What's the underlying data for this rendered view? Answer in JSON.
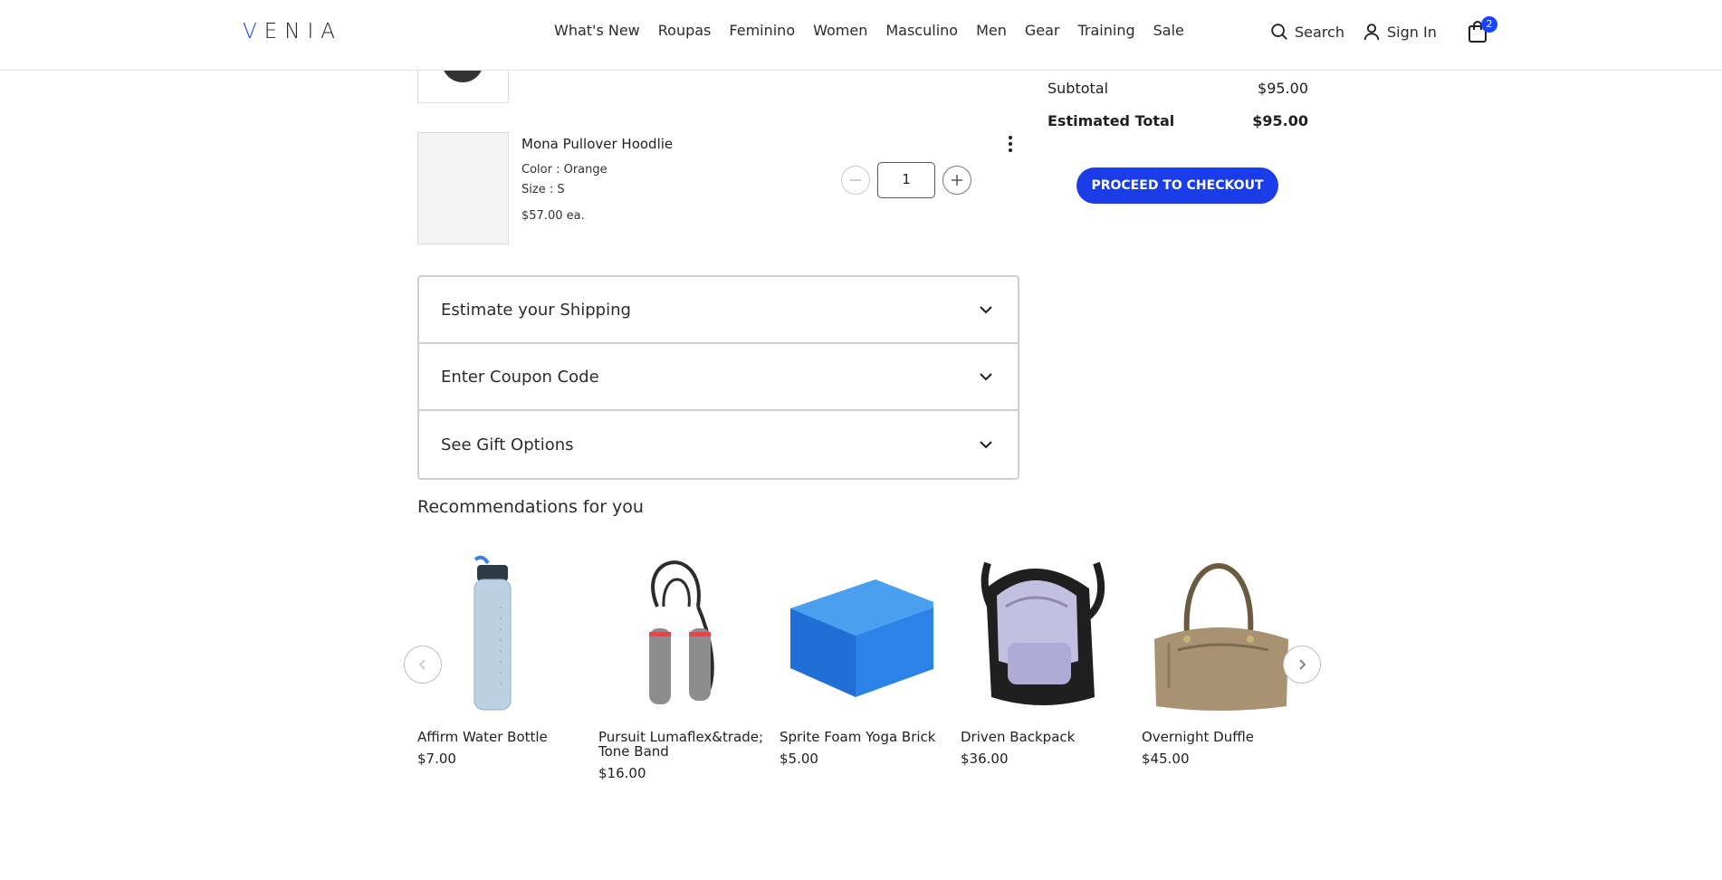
{
  "header": {
    "logo": "VENIA",
    "nav": [
      "What's New",
      "Roupas",
      "Feminino",
      "Women",
      "Masculino",
      "Men",
      "Gear",
      "Training",
      "Sale"
    ],
    "search_label": "Search",
    "signin_label": "Sign In",
    "cart_count": "2",
    "accent_color": "#1a44ff"
  },
  "cart": {
    "item": {
      "name": "Mona Pullover Hoodlie",
      "color": "Color : Orange",
      "size": "Size : S",
      "price": "$57.00 ea.",
      "quantity": "1"
    }
  },
  "summary": {
    "subtotal_label": "Subtotal",
    "subtotal_value": "$95.00",
    "total_label": "Estimated Total",
    "total_value": "$95.00",
    "checkout_label": "PROCEED TO CHECKOUT"
  },
  "accordion": [
    "Estimate your Shipping",
    "Enter Coupon Code",
    "See Gift Options"
  ],
  "recommendations": {
    "title": "Recommendations for you",
    "items": [
      {
        "name": "Affirm Water Bottle",
        "price": "$7.00",
        "icon": "water-bottle"
      },
      {
        "name": "Pursuit Lumaflex&trade; Tone Band",
        "price": "$16.00",
        "icon": "tone-band"
      },
      {
        "name": "Sprite Foam Yoga Brick",
        "price": "$5.00",
        "icon": "yoga-brick"
      },
      {
        "name": "Driven Backpack",
        "price": "$36.00",
        "icon": "backpack"
      },
      {
        "name": "Overnight Duffle",
        "price": "$45.00",
        "icon": "duffle-bag"
      }
    ]
  }
}
